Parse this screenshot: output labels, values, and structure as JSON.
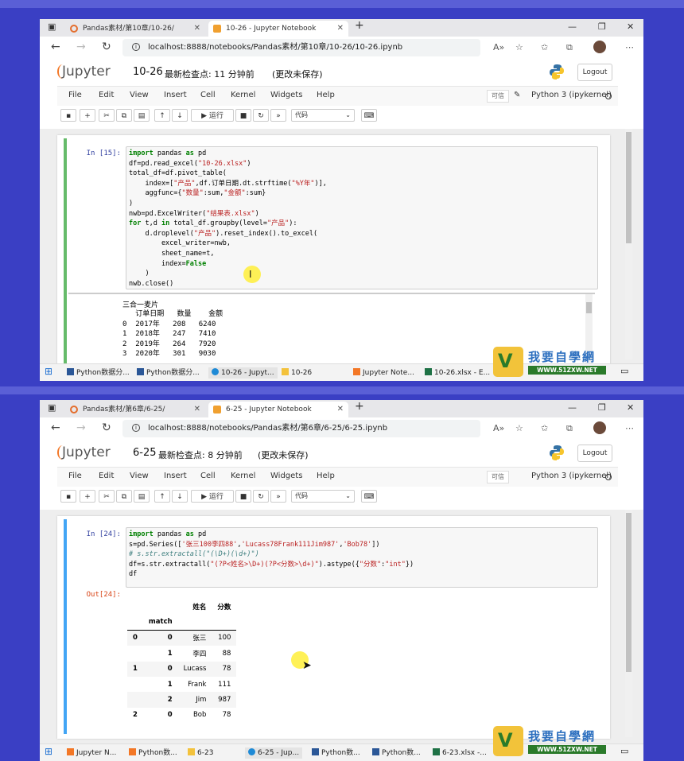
{
  "window1": {
    "tabs": [
      {
        "label": "Pandas素材/第10章/10-26/",
        "active": false
      },
      {
        "label": "10-26 - Jupyter Notebook",
        "active": true
      }
    ],
    "url": "localhost:8888/notebooks/Pandas素材/第10章/10-26/10-26.ipynb",
    "notebook_name": "10-26",
    "checkpoint": "最新检查点: 11 分钟前",
    "unsaved": "(更改未保存)",
    "logout": "Logout",
    "menus": [
      "File",
      "Edit",
      "View",
      "Insert",
      "Cell",
      "Kernel",
      "Widgets",
      "Help"
    ],
    "trusted": "可信",
    "kernel": "Python 3 (ipykernel)",
    "run_label": "运行",
    "cell_type": "代码",
    "cell": {
      "prompt": "In [15]:",
      "code_lines": [
        "import pandas as pd",
        "df=pd.read_excel(\"10-26.xlsx\")",
        "total_df=df.pivot_table(",
        "    index=[\"产品\",df.订单日期.dt.strftime(\"%Y年\")],",
        "    aggfunc={\"数量\":sum,\"金额\":sum}",
        ")",
        "nwb=pd.ExcelWriter(\"结果表.xlsx\")",
        "for t,d in total_df.groupby(level=\"产品\"):",
        "    d.droplevel(\"产品\").reset_index().to_excel(",
        "        excel_writer=nwb,",
        "        sheet_name=t,",
        "        index=False",
        "    )",
        "nwb.close()"
      ]
    },
    "output": {
      "title": "三合一麦片",
      "columns": [
        "订单日期",
        "数量",
        "金额"
      ],
      "rows": [
        {
          "idx": "0",
          "date": "2017年",
          "qty": "208",
          "amt": "6240"
        },
        {
          "idx": "1",
          "date": "2018年",
          "qty": "247",
          "amt": "7410"
        },
        {
          "idx": "2",
          "date": "2019年",
          "qty": "264",
          "amt": "7920"
        },
        {
          "idx": "3",
          "date": "2020年",
          "qty": "301",
          "amt": "9030"
        }
      ]
    },
    "taskbar": [
      "Python数据分...",
      "Python数据分...",
      "10-26 - Jupyt...",
      "10-26",
      "Jupyter Note...",
      "10-26.xlsx - E..."
    ]
  },
  "window2": {
    "tabs": [
      {
        "label": "Pandas素材/第6章/6-25/",
        "active": false
      },
      {
        "label": "6-25 - Jupyter Notebook",
        "active": true
      }
    ],
    "url": "localhost:8888/notebooks/Pandas素材/第6章/6-25/6-25.ipynb",
    "notebook_name": "6-25",
    "checkpoint": "最新检查点: 8 分钟前",
    "unsaved": "(更改未保存)",
    "logout": "Logout",
    "menus": [
      "File",
      "Edit",
      "View",
      "Insert",
      "Cell",
      "Kernel",
      "Widgets",
      "Help"
    ],
    "trusted": "可信",
    "kernel": "Python 3 (ipykernel)",
    "run_label": "运行",
    "cell_type": "代码",
    "cell": {
      "prompt": "In [24]:",
      "out_prompt": "Out[24]:",
      "code_lines": [
        "import pandas as pd",
        "s=pd.Series(['张三100李四88','Lucass78Frank111Jim987','Bob78'])",
        "# s.str.extractall(\"(\\D+)(\\d+)\")",
        "df=s.str.extractall(\"(?P<姓名>\\D+)(?P<分数>\\d+)\").astype({\"分数\":\"int\"})",
        "df"
      ]
    },
    "output": {
      "columns": [
        "姓名",
        "分数"
      ],
      "index_name": "match",
      "rows": [
        {
          "lvl0": "0",
          "match": "0",
          "name": "张三",
          "score": "100"
        },
        {
          "lvl0": "",
          "match": "1",
          "name": "李四",
          "score": "88"
        },
        {
          "lvl0": "1",
          "match": "0",
          "name": "Lucass",
          "score": "78"
        },
        {
          "lvl0": "",
          "match": "1",
          "name": "Frank",
          "score": "111"
        },
        {
          "lvl0": "",
          "match": "2",
          "name": "Jim",
          "score": "987"
        },
        {
          "lvl0": "2",
          "match": "0",
          "name": "Bob",
          "score": "78"
        }
      ]
    },
    "taskbar": [
      "Jupyter N...",
      "Python数...",
      "6-23",
      "6-25 - Jup...",
      "Python数...",
      "Python数...",
      "6-23.xlsx -..."
    ]
  },
  "watermark": {
    "text": "我要自學網",
    "url": "WWW.51ZXW.NET"
  }
}
